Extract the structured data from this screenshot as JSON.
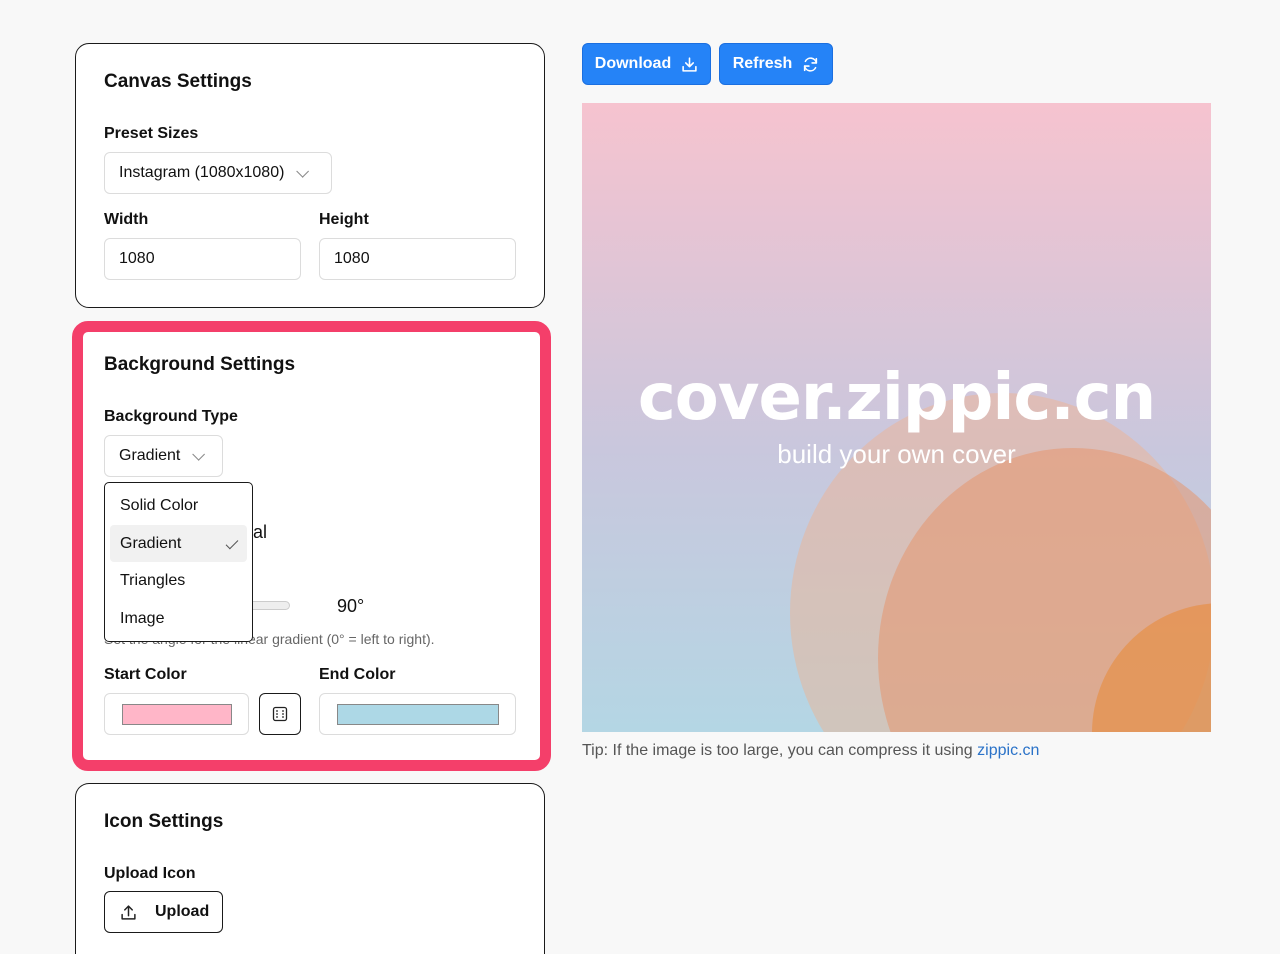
{
  "canvas": {
    "title": "Canvas Settings",
    "preset_label": "Preset Sizes",
    "preset_value": "Instagram (1080x1080)",
    "width_label": "Width",
    "width_value": "1080",
    "height_label": "Height",
    "height_value": "1080"
  },
  "background": {
    "title": "Background Settings",
    "type_label": "Background Type",
    "type_value": "Gradient",
    "type_options": [
      "Solid Color",
      "Gradient",
      "Triangles",
      "Image"
    ],
    "hidden_radio_fragment": "ial",
    "angle_value": "90°",
    "angle_help": "Set the angle for the linear gradient (0° = left to right).",
    "start_label": "Start Color",
    "end_label": "End Color",
    "start_color": "#ffb6c8",
    "end_color": "#add8e6",
    "highlight_color": "#f43f6a"
  },
  "icon": {
    "title": "Icon Settings",
    "upload_label": "Upload Icon",
    "upload_button": "Upload"
  },
  "toolbar": {
    "download_label": "Download",
    "refresh_label": "Refresh",
    "accent": "#2583f7"
  },
  "preview": {
    "title": "cover.zippic.cn",
    "subtitle": "build your own cover"
  },
  "tip": {
    "text": "Tip: If the image is too large, you can compress it using ",
    "link": "zippic.cn"
  }
}
